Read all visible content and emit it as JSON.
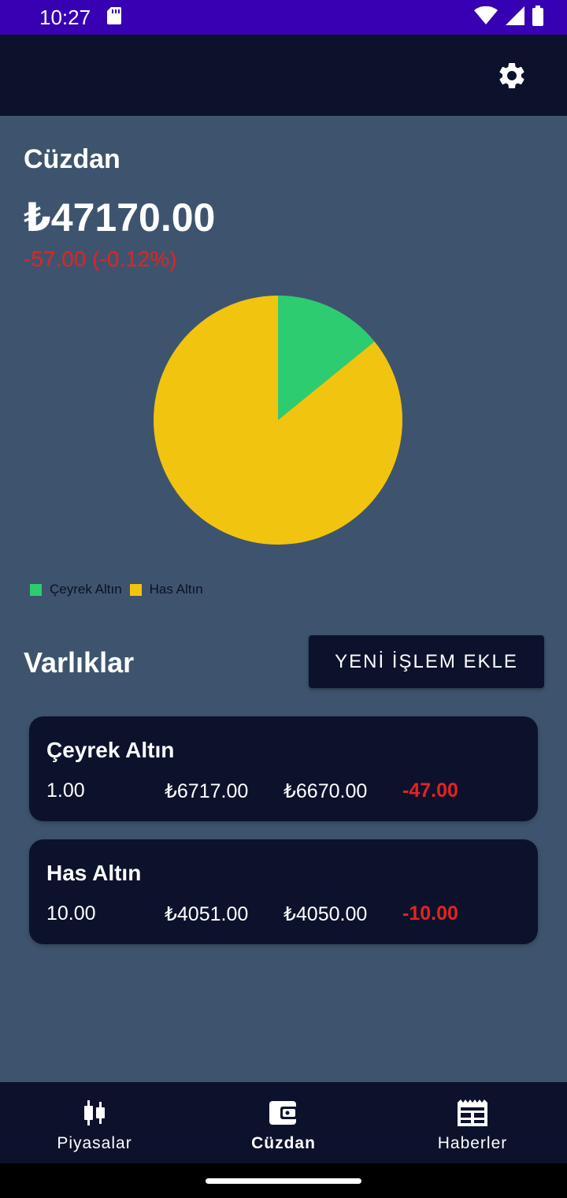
{
  "status_bar": {
    "time": "10:27"
  },
  "wallet": {
    "title": "Cüzdan",
    "total": "₺47170.00",
    "change": "-57.00 (-0.12%)"
  },
  "chart_data": {
    "type": "pie",
    "categories": [
      "Çeyrek Altın",
      "Has Altın"
    ],
    "values": [
      6670.0,
      40500.0
    ],
    "colors": [
      "#2ecc71",
      "#f1c40f"
    ],
    "legend_position": "bottom-left"
  },
  "legend": [
    {
      "label": "Çeyrek Altın",
      "color": "#2ecc71"
    },
    {
      "label": "Has Altın",
      "color": "#f1c40f"
    }
  ],
  "assets": {
    "title": "Varlıklar",
    "add_button": "YENİ İŞLEM EKLE",
    "items": [
      {
        "name": "Çeyrek Altın",
        "quantity": "1.00",
        "buy_price": "₺6717.00",
        "current_price": "₺6670.00",
        "profit_loss": "-47.00"
      },
      {
        "name": "Has Altın",
        "quantity": "10.00",
        "buy_price": "₺4051.00",
        "current_price": "₺4050.00",
        "profit_loss": "-10.00"
      }
    ]
  },
  "bottom_nav": {
    "items": [
      {
        "label": "Piyasalar",
        "icon": "candlestick-icon"
      },
      {
        "label": "Cüzdan",
        "icon": "wallet-icon",
        "active": true
      },
      {
        "label": "Haberler",
        "icon": "newspaper-icon"
      }
    ]
  },
  "colors": {
    "app_bar": "#0c122b",
    "background": "#3e546e",
    "negative": "#e52222",
    "status_bar": "#3700b3"
  }
}
